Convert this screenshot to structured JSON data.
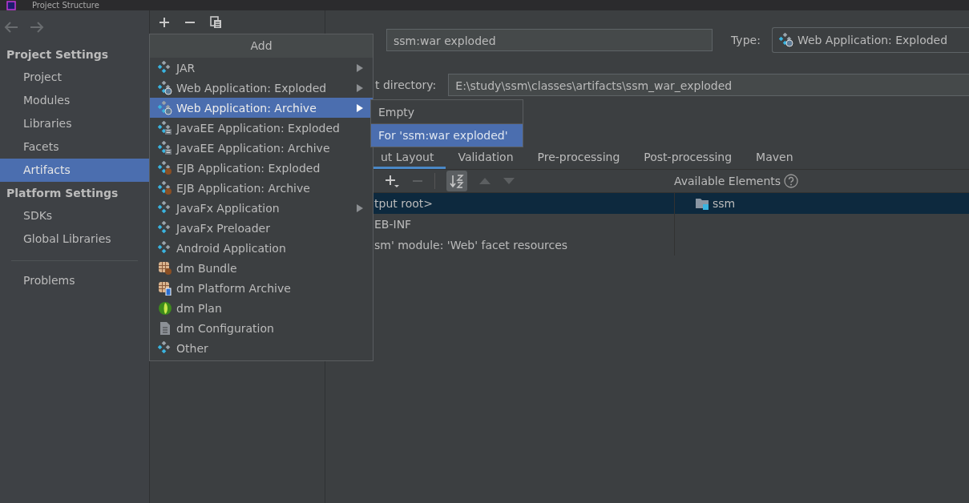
{
  "window": {
    "title": "Project Structure"
  },
  "sidebar": {
    "sections": [
      {
        "title": "Project Settings",
        "items": [
          {
            "label": "Project",
            "selected": false
          },
          {
            "label": "Modules",
            "selected": false
          },
          {
            "label": "Libraries",
            "selected": false
          },
          {
            "label": "Facets",
            "selected": false
          },
          {
            "label": "Artifacts",
            "selected": true
          }
        ]
      },
      {
        "title": "Platform Settings",
        "items": [
          {
            "label": "SDKs",
            "selected": false
          },
          {
            "label": "Global Libraries",
            "selected": false
          }
        ]
      }
    ],
    "extra_items": [
      {
        "label": "Problems",
        "selected": false
      }
    ]
  },
  "artifact": {
    "name": "ssm:war exploded",
    "type_label": "Type:",
    "type_value": "Web Application: Exploded",
    "dir_label": "t directory:",
    "dir_value": "E:\\study\\ssm\\classes\\artifacts\\ssm_war_exploded"
  },
  "tabs": [
    {
      "label": "ut Layout",
      "selected": true
    },
    {
      "label": "Validation",
      "selected": false
    },
    {
      "label": "Pre-processing",
      "selected": false
    },
    {
      "label": "Post-processing",
      "selected": false
    },
    {
      "label": "Maven",
      "selected": false
    }
  ],
  "layout_tree": {
    "rows": [
      {
        "label": "tput root>",
        "selected": true
      },
      {
        "label": "EB-INF",
        "selected": false
      },
      {
        "label": "sm' module: 'Web' facet resources",
        "selected": false
      }
    ]
  },
  "available_elements": {
    "title": "Available Elements",
    "items": [
      {
        "label": "ssm"
      }
    ]
  },
  "add_menu": {
    "title": "Add",
    "items": [
      {
        "label": "JAR",
        "kind": "jar",
        "has_submenu": true,
        "selected": false
      },
      {
        "label": "Web Application: Exploded",
        "kind": "web",
        "has_submenu": true,
        "selected": false
      },
      {
        "label": "Web Application: Archive",
        "kind": "web",
        "has_submenu": true,
        "selected": true
      },
      {
        "label": "JavaEE Application: Exploded",
        "kind": "javaee",
        "has_submenu": false,
        "selected": false
      },
      {
        "label": "JavaEE Application: Archive",
        "kind": "javaee",
        "has_submenu": false,
        "selected": false
      },
      {
        "label": "EJB Application: Exploded",
        "kind": "ejb",
        "has_submenu": false,
        "selected": false
      },
      {
        "label": "EJB Application: Archive",
        "kind": "ejb",
        "has_submenu": false,
        "selected": false
      },
      {
        "label": "JavaFx Application",
        "kind": "jar",
        "has_submenu": true,
        "selected": false
      },
      {
        "label": "JavaFx Preloader",
        "kind": "jar",
        "has_submenu": false,
        "selected": false
      },
      {
        "label": "Android Application",
        "kind": "jar",
        "has_submenu": false,
        "selected": false
      },
      {
        "label": "dm Bundle",
        "kind": "bundle",
        "has_submenu": false,
        "selected": false
      },
      {
        "label": "dm Platform Archive",
        "kind": "platform",
        "has_submenu": false,
        "selected": false
      },
      {
        "label": "dm Plan",
        "kind": "plan",
        "has_submenu": false,
        "selected": false
      },
      {
        "label": "dm Configuration",
        "kind": "config",
        "has_submenu": false,
        "selected": false
      },
      {
        "label": "Other",
        "kind": "jar",
        "has_submenu": false,
        "selected": false
      }
    ]
  },
  "submenu": {
    "items": [
      {
        "label": "Empty",
        "selected": false
      },
      {
        "label": "For 'ssm:war exploded'",
        "selected": true
      }
    ]
  }
}
